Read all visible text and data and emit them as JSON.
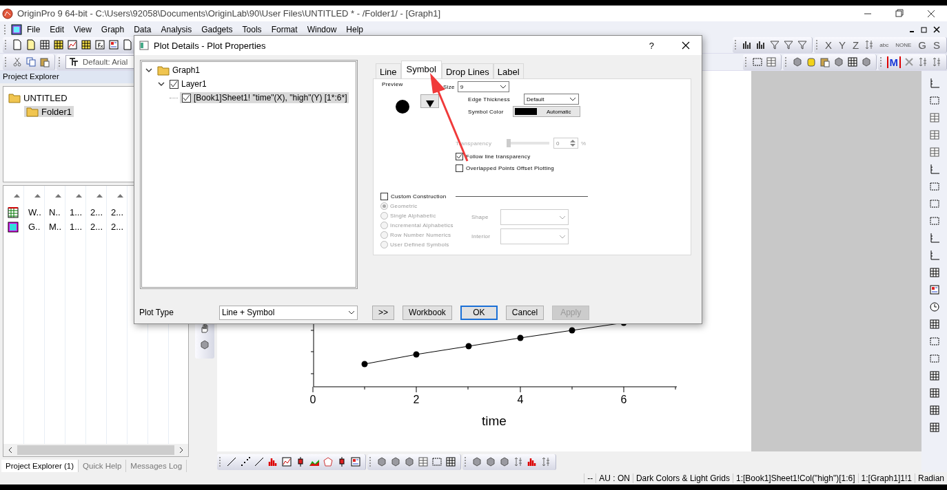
{
  "window": {
    "title": "OriginPro 9 64-bit - C:\\Users\\92058\\Documents\\OriginLab\\90\\User Files\\UNTITLED * - /Folder1/ - [Graph1]"
  },
  "menu": [
    "File",
    "Edit",
    "View",
    "Graph",
    "Data",
    "Analysis",
    "Gadgets",
    "Tools",
    "Format",
    "Window",
    "Help"
  ],
  "toolbar": {
    "font_box": "Default: Arial",
    "axis_buttons": [
      "X",
      "Y",
      "Z"
    ],
    "label_buttons": [
      "abc",
      "NONE"
    ],
    "letter_buttons": [
      "G",
      "S"
    ],
    "mask_button": "M"
  },
  "project_explorer": {
    "title": "Project Explorer",
    "tree": [
      {
        "label": "UNTITLED",
        "selected": false,
        "children": [
          {
            "label": "Folder1",
            "selected": true
          }
        ]
      }
    ],
    "list_rows": [
      {
        "kind": "workbook",
        "cells": [
          "W..",
          "N..",
          "1...",
          "2...",
          "2..."
        ]
      },
      {
        "kind": "graph",
        "cells": [
          "G..",
          "M..",
          "1...",
          "2...",
          "2..."
        ]
      }
    ],
    "tabs": [
      {
        "label": "Project Explorer (1)",
        "selected": true
      },
      {
        "label": "Quick Help",
        "selected": false
      },
      {
        "label": "Messages Log",
        "selected": false
      }
    ]
  },
  "graph": {
    "x_tick_labels": [
      "0",
      "2",
      "4",
      "6"
    ],
    "x_title": "time"
  },
  "dialog": {
    "title": "Plot Details - Plot Properties",
    "help": "?",
    "tree": [
      {
        "label": "Graph1",
        "kind": "graph",
        "expanded": true,
        "children": [
          {
            "label": "Layer1",
            "checked": true,
            "expanded": true,
            "children": [
              {
                "label": "[Book1]Sheet1! \"time\"(X), \"high\"(Y) [1*:6*]",
                "checked": true,
                "selected": true
              }
            ]
          }
        ]
      }
    ],
    "tabs": [
      {
        "label": "Line",
        "selected": false
      },
      {
        "label": "Symbol",
        "selected": true
      },
      {
        "label": "Drop Lines",
        "selected": false
      },
      {
        "label": "Label",
        "selected": false
      }
    ],
    "symbol": {
      "preview_label": "Preview",
      "size_label": "Size",
      "size": "9",
      "edge_label": "Edge Thickness",
      "edge": "Default",
      "color_label": "Symbol Color",
      "color": "#000000",
      "color_name": "Automatic",
      "transparency_label": "Transparency",
      "transparency_disabled": true,
      "transparency": {
        "level": 0
      },
      "transparency_value": "0",
      "percent": "%",
      "options": [
        {
          "label": "Follow line transparency",
          "checked": true
        },
        {
          "label": "Overlapped Points Offset Plotting",
          "checked": false
        }
      ],
      "custom": {
        "label": "Custom Construction",
        "checked": false
      },
      "construction_disabled": true,
      "construction": [
        {
          "label": "Geometric",
          "selected": true
        },
        {
          "label": "Single Alphabetic",
          "selected": false
        },
        {
          "label": "Incremental Alphabetics",
          "selected": false
        },
        {
          "label": "Row Number Numerics",
          "selected": false
        },
        {
          "label": "User Defined Symbols",
          "selected": false
        }
      ],
      "shape_label": "Shape",
      "interior_label": "Interior"
    },
    "plot_type_label": "Plot Type",
    "plot_type": "Line + Symbol",
    "buttons": [
      {
        "label": ">>",
        "default": false,
        "disabled": false
      },
      {
        "label": "Workbook",
        "default": false,
        "disabled": false
      },
      {
        "label": "OK",
        "default": true,
        "disabled": false
      },
      {
        "label": "Cancel",
        "default": false,
        "disabled": false
      },
      {
        "label": "Apply",
        "default": false,
        "disabled": true
      }
    ]
  },
  "status_bar": [
    "--",
    "AU : ON",
    "Dark Colors & Light Grids",
    "1:[Book1]Sheet1!Col(\"high\")[1:6]",
    "1:[Graph1]1!1",
    "Radian"
  ]
}
